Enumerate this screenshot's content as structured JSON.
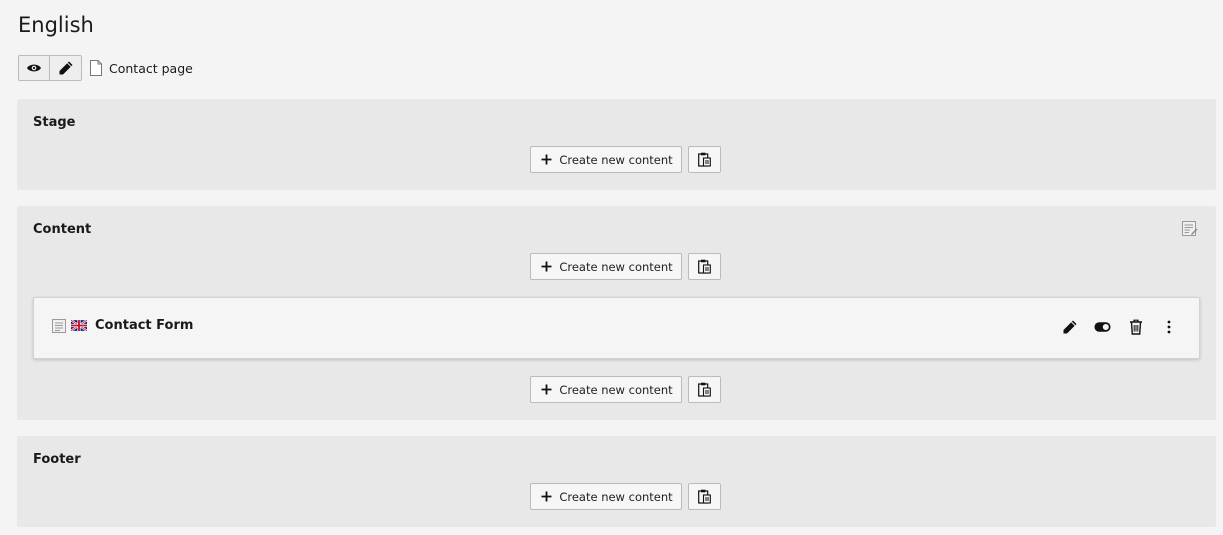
{
  "page": {
    "language": "English",
    "page_name": "Contact page"
  },
  "columns": [
    {
      "title": "Stage",
      "create_label": "Create new content"
    },
    {
      "title": "Content",
      "create_label": "Create new content",
      "create_label_after": "Create new content"
    },
    {
      "title": "Footer",
      "create_label": "Create new content"
    }
  ],
  "content_element": {
    "title": "Contact Form",
    "language_flag": "uk-flag-icon",
    "type_icon": "text-content-icon"
  },
  "icons": {
    "view": "eye-icon",
    "edit": "pencil-icon",
    "page": "page-icon",
    "plus": "plus-icon",
    "paste": "clipboard-icon",
    "toggle": "toggle-icon",
    "delete": "trash-icon",
    "more": "more-vertical-icon",
    "layout": "layout-edit-icon"
  }
}
